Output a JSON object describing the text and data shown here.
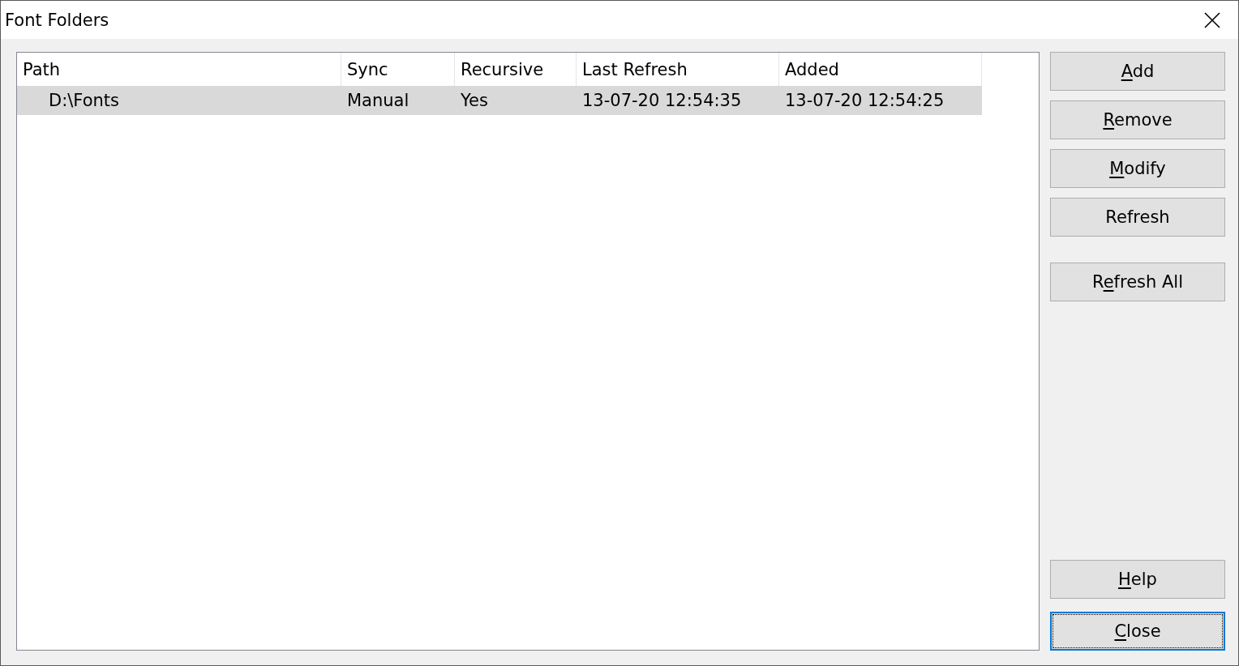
{
  "window": {
    "title": "Font Folders"
  },
  "table": {
    "columns": [
      "Path",
      "Sync",
      "Recursive",
      "Last Refresh",
      "Added"
    ],
    "rows": [
      {
        "selected": true,
        "cells": [
          "D:\\Fonts",
          "Manual",
          "Yes",
          "13-07-20 12:54:35",
          "13-07-20 12:54:25"
        ]
      }
    ]
  },
  "button_groups": [
    [
      {
        "label": [
          {
            "text": "A",
            "underlined": true
          },
          {
            "text": "dd",
            "underlined": false
          }
        ],
        "focused": false
      },
      {
        "label": [
          {
            "text": "R",
            "underlined": true
          },
          {
            "text": "emove",
            "underlined": false
          }
        ],
        "focused": false
      },
      {
        "label": [
          {
            "text": "M",
            "underlined": true
          },
          {
            "text": "odify",
            "underlined": false
          }
        ],
        "focused": false
      },
      {
        "label": [
          {
            "text": "Refresh",
            "underlined": false
          }
        ],
        "focused": false
      }
    ],
    [
      {
        "label": [
          {
            "text": "R",
            "underlined": false
          },
          {
            "text": "e",
            "underlined": true
          },
          {
            "text": "fresh All",
            "underlined": false
          }
        ],
        "focused": false
      }
    ]
  ],
  "bottom_buttons": [
    {
      "label": [
        {
          "text": "H",
          "underlined": true
        },
        {
          "text": "elp",
          "underlined": false
        }
      ],
      "focused": false
    },
    {
      "label": [
        {
          "text": "C",
          "underlined": true
        },
        {
          "text": "lose",
          "underlined": false
        }
      ],
      "focused": true
    }
  ]
}
